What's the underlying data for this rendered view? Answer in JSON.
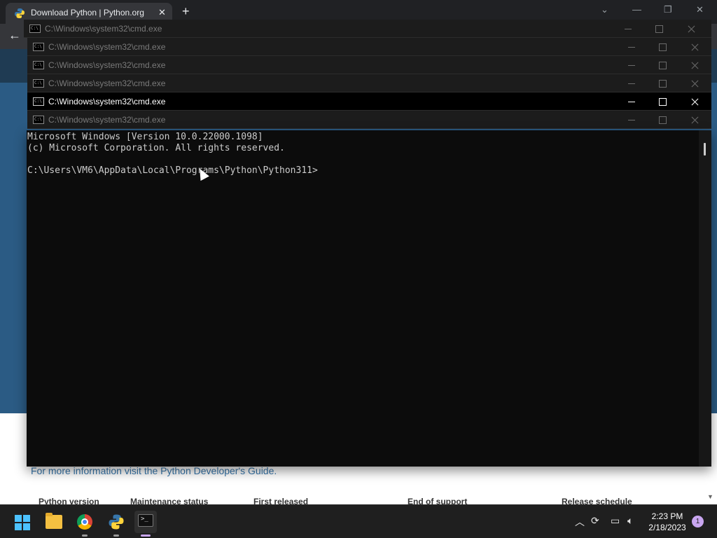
{
  "browser": {
    "tab_title": "Download Python | Python.org",
    "new_tab_label": "+",
    "tab_close_label": "✕",
    "page_text": "For more information visit the Python Developer's Guide.",
    "table_headers": [
      "Python version",
      "Maintenance status",
      "First released",
      "End of support",
      "Release schedule"
    ]
  },
  "cmd_windows": [
    {
      "title": "C:\\Windows\\system32\\cmd.exe",
      "active": false
    },
    {
      "title": "C:\\Windows\\system32\\cmd.exe",
      "active": false
    },
    {
      "title": "C:\\Windows\\system32\\cmd.exe",
      "active": false
    },
    {
      "title": "C:\\Windows\\system32\\cmd.exe",
      "active": false
    },
    {
      "title": "C:\\Windows\\system32\\cmd.exe",
      "active": true
    },
    {
      "title": "C:\\Windows\\system32\\cmd.exe",
      "active": false
    }
  ],
  "console": {
    "lines": [
      "Microsoft Windows [Version 10.0.22000.1098]",
      "(c) Microsoft Corporation. All rights reserved.",
      "",
      "C:\\Users\\VM6\\AppData\\Local\\Programs\\Python\\Python311>"
    ]
  },
  "taskbar": {
    "apps": [
      "start",
      "file-explorer",
      "chrome",
      "python",
      "command-prompt"
    ],
    "time": "2:23 PM",
    "date": "2/18/2023",
    "notification_count": "1"
  },
  "colors": {
    "console_bg": "#0c0c0c",
    "console_text": "#cccccc",
    "active_indicator": "#c9a6f0",
    "python_blue": "#2b5b84"
  }
}
